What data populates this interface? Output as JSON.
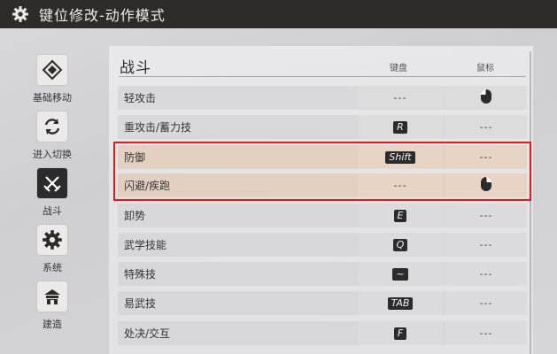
{
  "header": {
    "title": "键位修改-动作模式",
    "icon": "gear-icon"
  },
  "sidebar": {
    "items": [
      {
        "label": "基础移动",
        "icon": "diamond-move-icon",
        "active": false
      },
      {
        "label": "进入切换",
        "icon": "swap-arrows-icon",
        "active": false
      },
      {
        "label": "战斗",
        "icon": "crossed-swords-icon",
        "active": true
      },
      {
        "label": "系统",
        "icon": "gear-icon",
        "active": false
      },
      {
        "label": "建造",
        "icon": "house-icon",
        "active": false
      }
    ]
  },
  "section": {
    "title": "战斗",
    "col_keyboard": "键盘",
    "col_mouse": "鼠标"
  },
  "rows": [
    {
      "label": "轻攻击",
      "keyboard": "---",
      "mouse": "mouse-left-icon"
    },
    {
      "label": "重攻击/蓄力技",
      "keyboard": "R",
      "mouse": "---"
    },
    {
      "label": "防御",
      "keyboard": "Shift",
      "mouse": "---"
    },
    {
      "label": "闪避/疾跑",
      "keyboard": "---",
      "mouse": "mouse-right-icon"
    },
    {
      "label": "卸势",
      "keyboard": "E",
      "mouse": "---"
    },
    {
      "label": "武学技能",
      "keyboard": "Q",
      "mouse": "---"
    },
    {
      "label": "特殊技",
      "keyboard": "~",
      "mouse": "---"
    },
    {
      "label": "易武技",
      "keyboard": "TAB",
      "mouse": "---"
    },
    {
      "label": "处决/交互",
      "keyboard": "F",
      "mouse": "---"
    }
  ],
  "colors": {
    "highlight_border": "#e01818",
    "header_bg": "#2d2c2b",
    "keycap_bg": "#2b2b2b"
  }
}
